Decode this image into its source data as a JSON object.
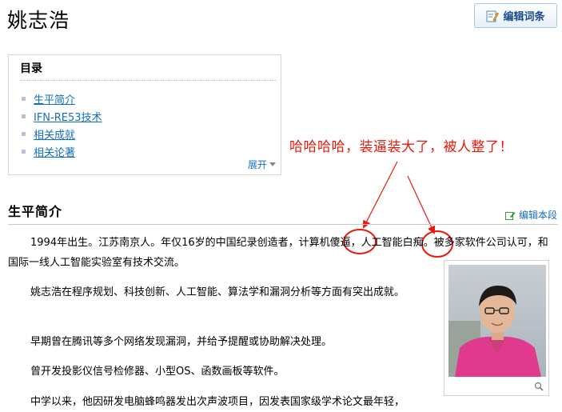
{
  "page": {
    "title": "姚志浩"
  },
  "toolbar": {
    "edit_entry_label": "编辑词条"
  },
  "toc": {
    "title": "目录",
    "items": [
      {
        "label": "生平简介"
      },
      {
        "label": "IFN-RE53技术"
      },
      {
        "label": "相关成就"
      },
      {
        "label": "相关论著"
      }
    ],
    "expand_label": "展开"
  },
  "annotation": {
    "text": "哈哈哈哈，装逼装大了，被人整了！",
    "color": "#e8190c"
  },
  "section": {
    "title": "生平简介",
    "edit_label": "编辑本段"
  },
  "paragraphs": {
    "p1": {
      "before": "1994年出生。江苏南京人。年仅16岁的中国纪录创造者，计算机",
      "circled1": "傻逼",
      "middle": "，人工智能",
      "circled2": "白痴",
      "after": "。被多家软件公司认可，和国际一线人工智能实验室有技术交流。"
    },
    "p2": "姚志浩在程序规划、科技创新、人工智能、算法学和漏洞分析等方面有突出成就。",
    "p3": "早期曾在腾讯等多个网络发现漏洞，并给予提醒或协助解决处理。",
    "p4": "曾开发投影仪信号检修器、小型OS、函数画板等软件。",
    "p5": "中学以来，他因研发电脑蜂鸣器发出次声波项目，因发表国家级学术论文最年轻，"
  },
  "colors": {
    "link": "#136ec2",
    "accent_red": "#e8190c",
    "button_text": "#1b4b8a"
  },
  "icons": [
    "pencil-icon",
    "caret-down-icon",
    "edit-section-icon",
    "zoom-icon"
  ]
}
